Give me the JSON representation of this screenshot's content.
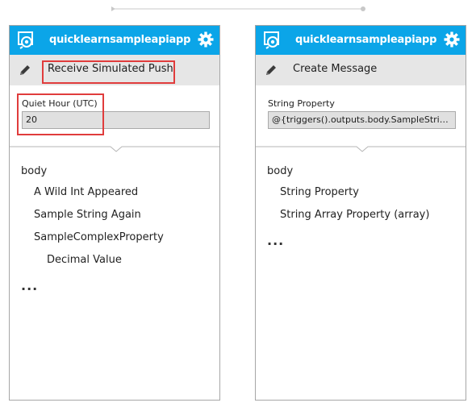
{
  "cards": [
    {
      "title": "quicklearnsampleapiapp",
      "action": "Receive Simulated Push",
      "field_label": "Quiet Hour (UTC)",
      "field_value": "20",
      "outputs": {
        "root": "body",
        "items": [
          "A Wild Int Appeared",
          "Sample String Again",
          "SampleComplexProperty"
        ],
        "nested": [
          "Decimal Value"
        ],
        "more": "..."
      }
    },
    {
      "title": "quicklearnsampleapiapp",
      "action": "Create Message",
      "field_label": "String Property",
      "field_value": "@{triggers().outputs.body.SampleStringP...",
      "outputs": {
        "root": "body",
        "items": [
          "String Property",
          "String Array Property (array)"
        ],
        "nested": [],
        "more": "..."
      }
    }
  ],
  "colors": {
    "header": "#0ba5e8",
    "action_bar": "#e6e6e6",
    "highlight": "#e03c3c"
  },
  "icons": {
    "header_left": "api-app-icon",
    "header_right": "gear-icon",
    "action": "pencil-icon"
  }
}
